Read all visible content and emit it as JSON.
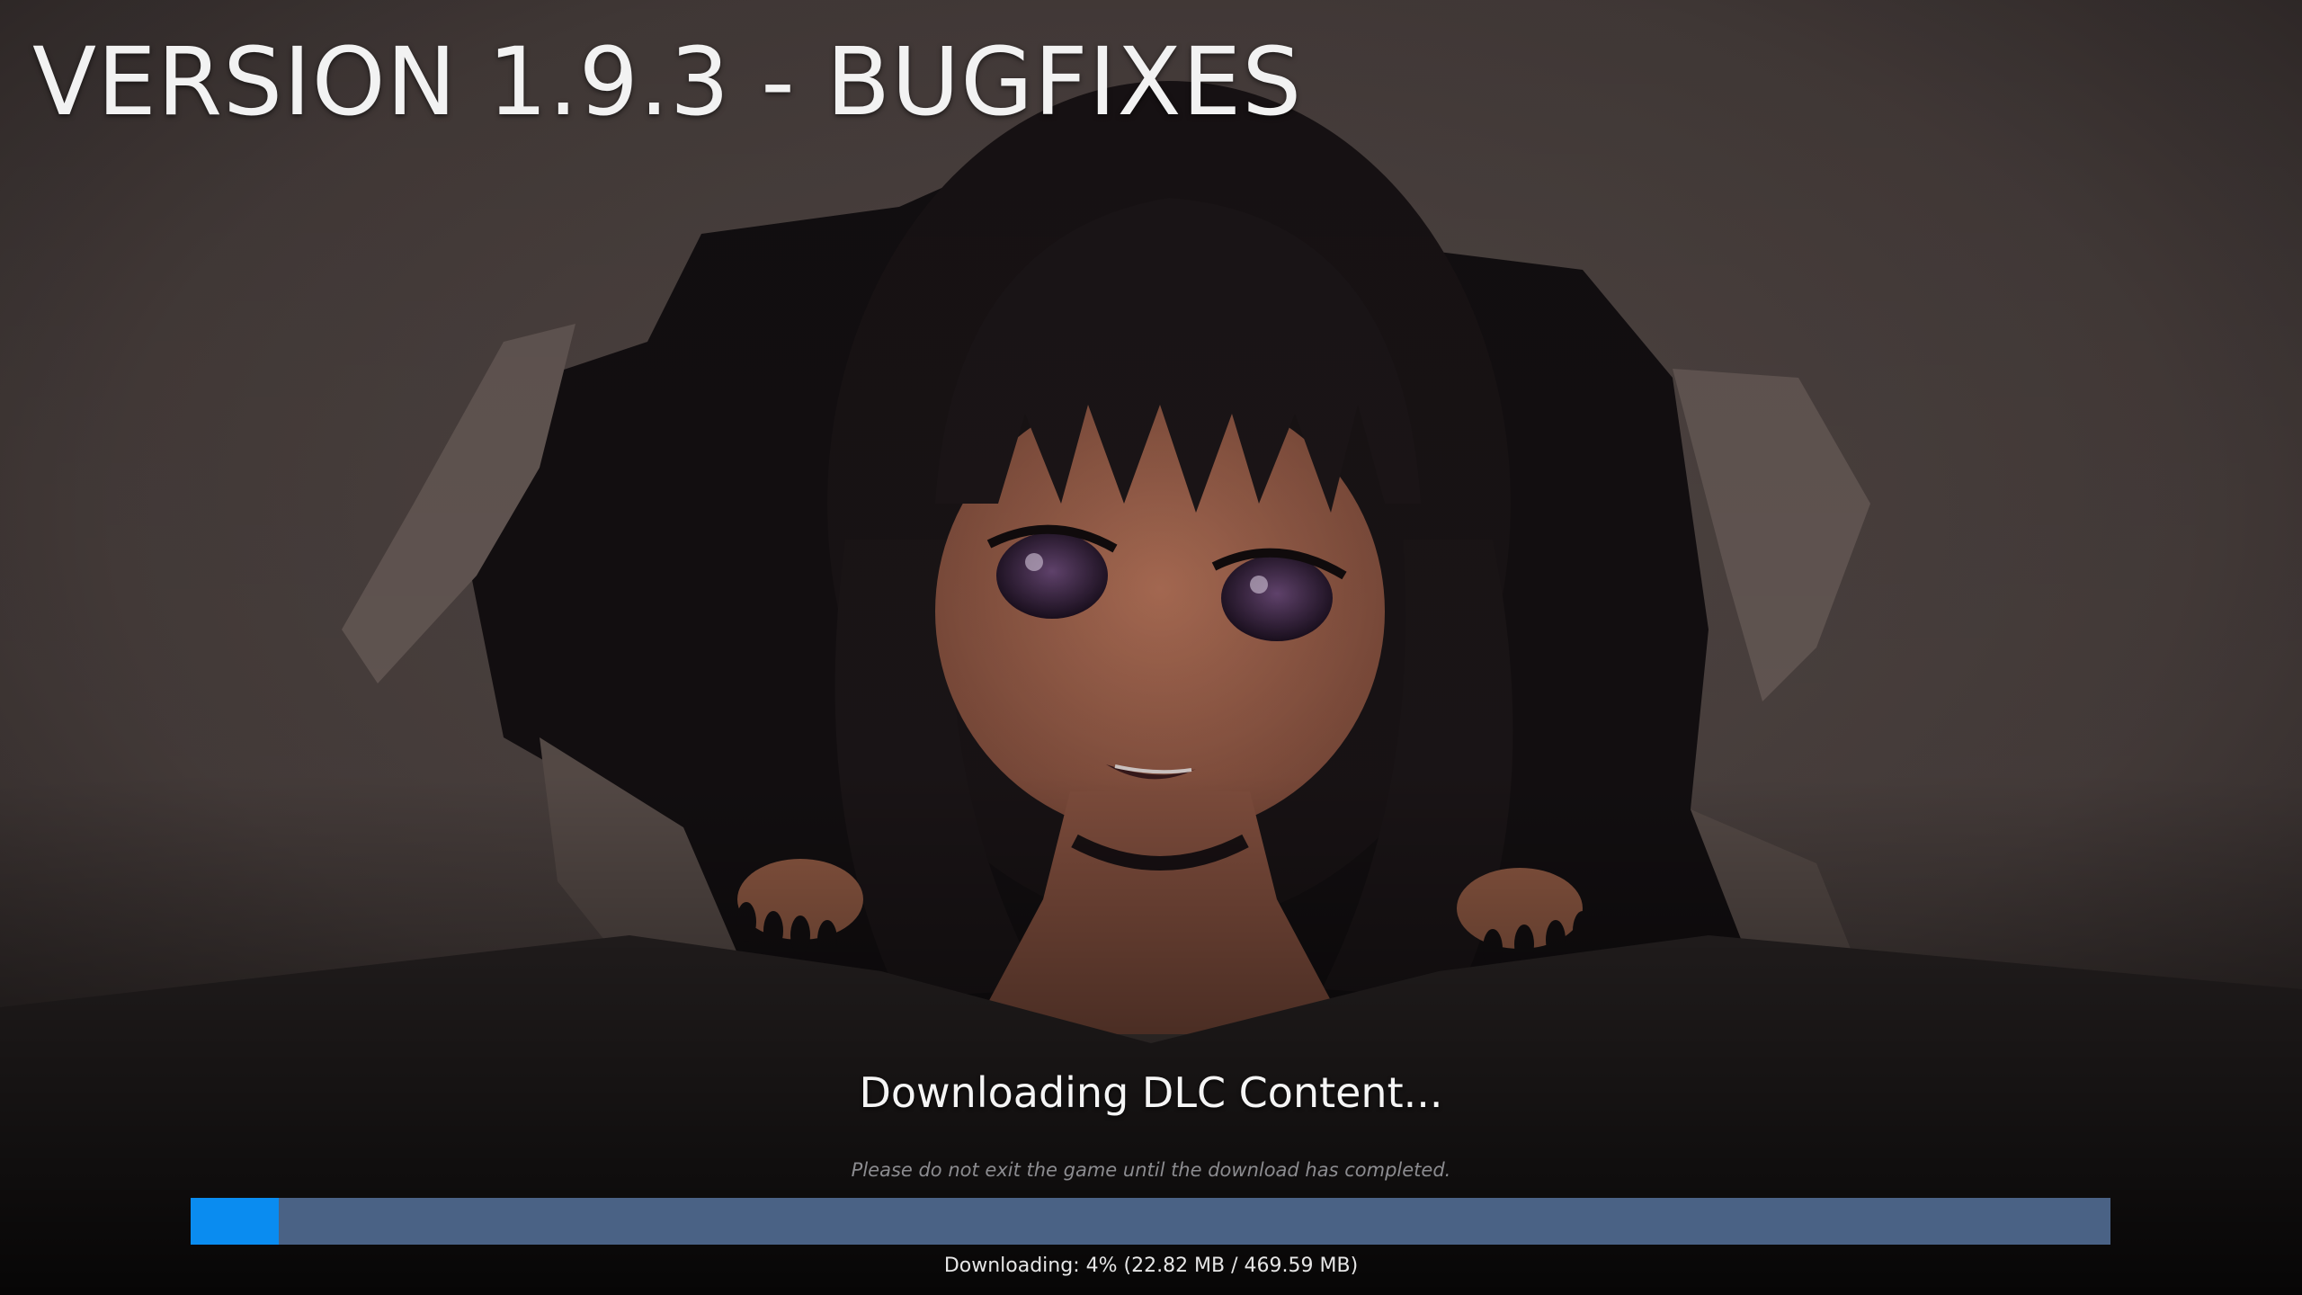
{
  "header": {
    "title": "VERSION 1.9.3 - BUGFIXES"
  },
  "download": {
    "heading": "Downloading DLC Content...",
    "warning": "Please do not exit the game until the download has completed.",
    "progress_fraction": 0.04,
    "status_text": "Downloading: 4% (22.82 MB / 469.59 MB)"
  },
  "colors": {
    "progress_fill": "#0a8cf0",
    "progress_track": "#4a6285",
    "title_text": "#f2f2f2"
  },
  "background": {
    "illustration": "anime-girl-peeking-through-torn-paper"
  }
}
